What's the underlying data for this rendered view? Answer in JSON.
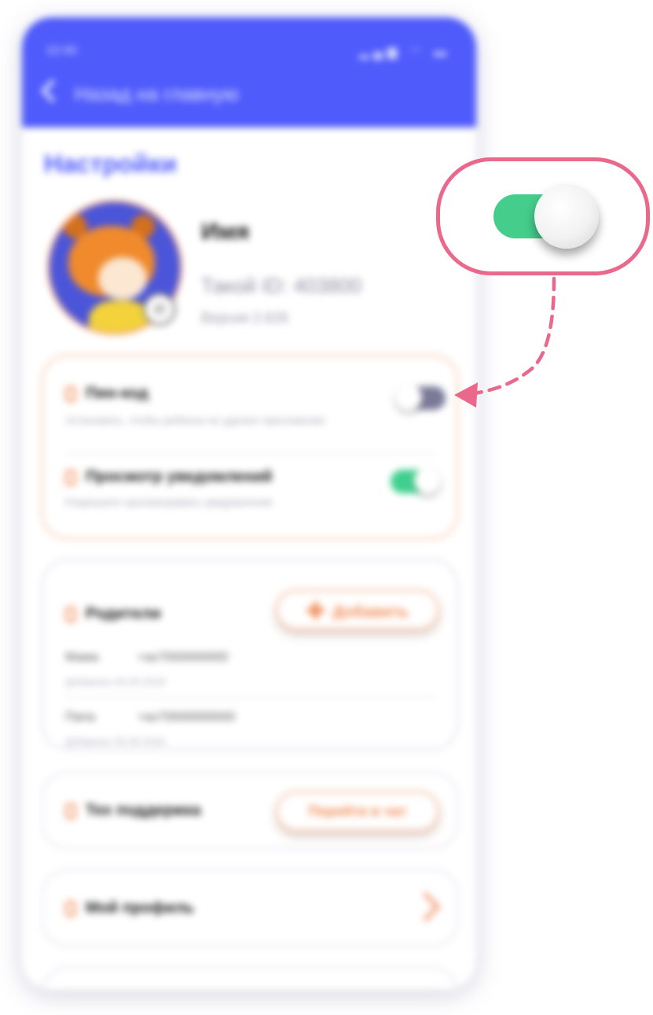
{
  "status_bar": {
    "time": "10:40",
    "icons": "▂▄▆ ◠ ▬"
  },
  "header": {
    "back_label": "Назад на главную"
  },
  "page": {
    "title": "Настройки"
  },
  "profile": {
    "name": "Имя",
    "id_label": "Такой ID: 403800",
    "version": "Версия 2.626"
  },
  "toggles": [
    {
      "title": "Пин-код",
      "subtitle": "Установить, чтобы ребенок не удалил приложение",
      "state": "off"
    },
    {
      "title": "Просмотр уведомлений",
      "subtitle": "Разрешите просматривать уведомления",
      "state": "on"
    }
  ],
  "parents": {
    "title": "Родители",
    "add_button": "Добавить",
    "items": [
      {
        "name": "Мама",
        "phone": "+ax7000000000",
        "added": "Добавлен 00.00.2020"
      },
      {
        "name": "Папа",
        "phone": "+ax70000000000",
        "added": "Добавлен 00.00.2020"
      }
    ]
  },
  "support": {
    "title": "Тех поддержка",
    "button": "Перейти в чат"
  },
  "my_profile": {
    "title": "Мой профиль"
  },
  "callout": {
    "toggle_state": "on"
  },
  "colors": {
    "brand": "#4f5bfb",
    "accent": "#f08a55",
    "toggle_on": "#3fcf8e",
    "toggle_off": "#7a7a98",
    "callout": "#e9688c"
  }
}
